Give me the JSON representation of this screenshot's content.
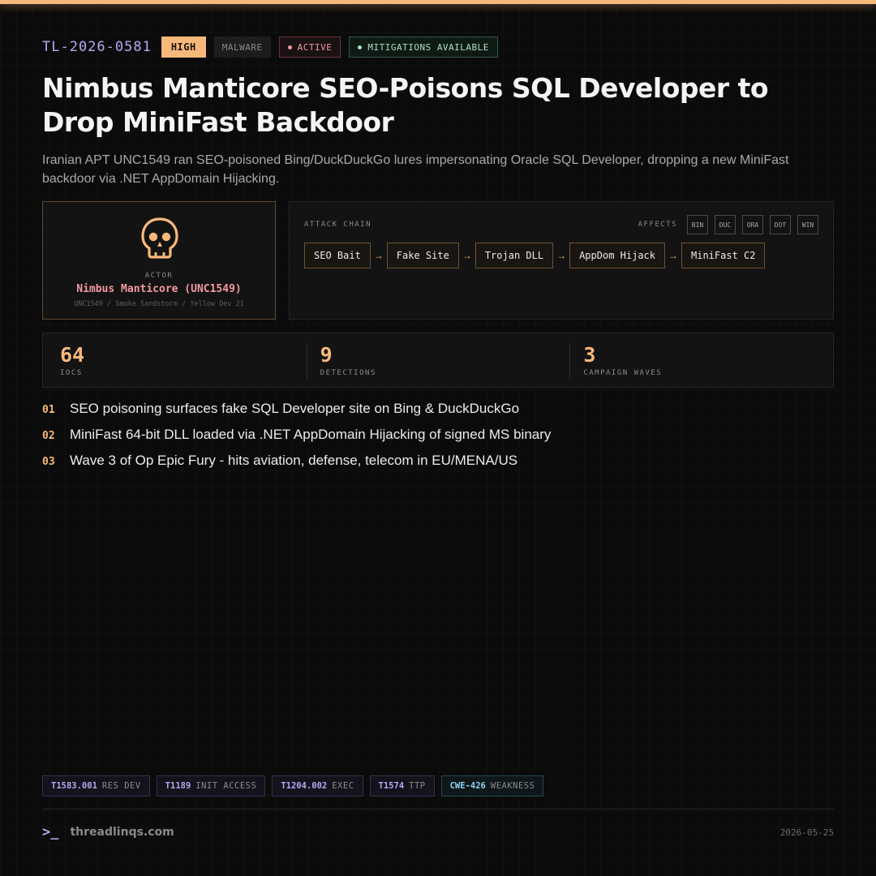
{
  "header": {
    "id": "TL-2026-0581",
    "severity": "HIGH",
    "category": "MALWARE",
    "status": "ACTIVE",
    "mitigation": "MITIGATIONS AVAILABLE"
  },
  "title": "Nimbus Manticore SEO-Poisons SQL Developer to Drop MiniFast Backdoor",
  "subtitle": "Iranian APT UNC1549 ran SEO-poisoned Bing/DuckDuckGo lures impersonating Oracle SQL Developer, dropping a new MiniFast backdoor via .NET AppDomain Hijacking.",
  "actor": {
    "icon": "skull-icon",
    "label": "ACTOR",
    "name": "Nimbus Manticore (UNC1549)",
    "aliases": "UNC1549 / Smoke Sandstorm / Yellow Dev 21"
  },
  "attack_chain": {
    "label": "ATTACK CHAIN",
    "affects_label": "AFFECTS",
    "affects": [
      "BIN",
      "DUC",
      "ORA",
      "DOT",
      "WIN"
    ],
    "steps": [
      "SEO Bait",
      "Fake Site",
      "Trojan DLL",
      "AppDom Hijack",
      "MiniFast C2"
    ],
    "arrow": "→"
  },
  "stats": [
    {
      "value": "64",
      "label": "IOCS"
    },
    {
      "value": "9",
      "label": "DETECTIONS"
    },
    {
      "value": "3",
      "label": "CAMPAIGN WAVES"
    }
  ],
  "points": [
    {
      "num": "01",
      "text": "SEO poisoning surfaces fake SQL Developer site on Bing & DuckDuckGo"
    },
    {
      "num": "02",
      "text": "MiniFast 64-bit DLL loaded via .NET AppDomain Hijacking of signed MS binary"
    },
    {
      "num": "03",
      "text": "Wave 3 of Op Epic Fury - hits aviation, defense, telecom in EU/MENA/US"
    }
  ],
  "tags": [
    {
      "id": "T1583.001",
      "desc": "RES DEV"
    },
    {
      "id": "T1189",
      "desc": "INIT ACCESS"
    },
    {
      "id": "T1204.002",
      "desc": "EXEC"
    },
    {
      "id": "T1574",
      "desc": "TTP"
    },
    {
      "id": "CWE-426",
      "desc": "WEAKNESS"
    }
  ],
  "footer": {
    "prompt": ">_",
    "brand": "threadlinqs.com",
    "date": "2026-05-25"
  },
  "colors": {
    "accent": "#f7b97a",
    "id": "#b6a8f2",
    "active": "#f09ca0",
    "mitigation": "#a6e1c4",
    "cwe": "#8fd3ef"
  }
}
